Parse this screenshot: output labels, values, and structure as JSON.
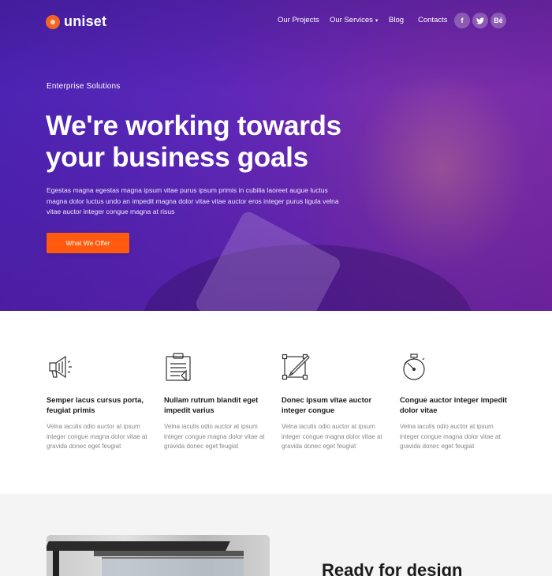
{
  "brand": {
    "name": "uniset",
    "accent": "#ff5a0d"
  },
  "nav": {
    "items": [
      {
        "label": "Our Projects"
      },
      {
        "label": "Our Services",
        "has_dropdown": true
      },
      {
        "label": "Blog"
      },
      {
        "label": "Contacts"
      }
    ],
    "social": [
      {
        "label": "f",
        "icon": "facebook-icon"
      },
      {
        "label": "t",
        "icon": "twitter-icon"
      },
      {
        "label": "Bē",
        "icon": "behance-icon"
      }
    ]
  },
  "hero": {
    "eyebrow": "Enterprise Solutions",
    "headline_line1": "We're working towards",
    "headline_line2": "your business goals",
    "lead": "Egestas magna egestas magna ipsum vitae purus ipsum primis in cubilia laoreet augue luctus magna dolor luctus undo an impedit magna dolor vitae vitae auctor eros integer purus ligula velna vitae auctor integer congue magna at risus",
    "cta_label": "What We Offer"
  },
  "features": [
    {
      "icon": "megaphone-icon",
      "title": "Semper lacus cursus porta, feugiat primis",
      "text": "Velna iaculis odio auctor at ipsum integer congue magna dolor vitae at gravida donec eget feugiat"
    },
    {
      "icon": "clipboard-icon",
      "title": "Nullam rutrum blandit eget impedit varius",
      "text": "Velna iaculis odio auctor at ipsum integer congue magna dolor vitae at gravida donec eget feugiat"
    },
    {
      "icon": "design-tools-icon",
      "title": "Donec ipsum vitae auctor integer congue",
      "text": "Velna iaculis odio auctor at ipsum integer congue magna dolor vitae at gravida donec eget feugiat"
    },
    {
      "icon": "stopwatch-icon",
      "title": "Congue auctor integer impedit dolor vitae",
      "text": "Velna iaculis odio auctor at ipsum integer congue magna dolor vitae at gravida donec eget feugiat"
    }
  ],
  "section3": {
    "heading": "Ready for design"
  }
}
